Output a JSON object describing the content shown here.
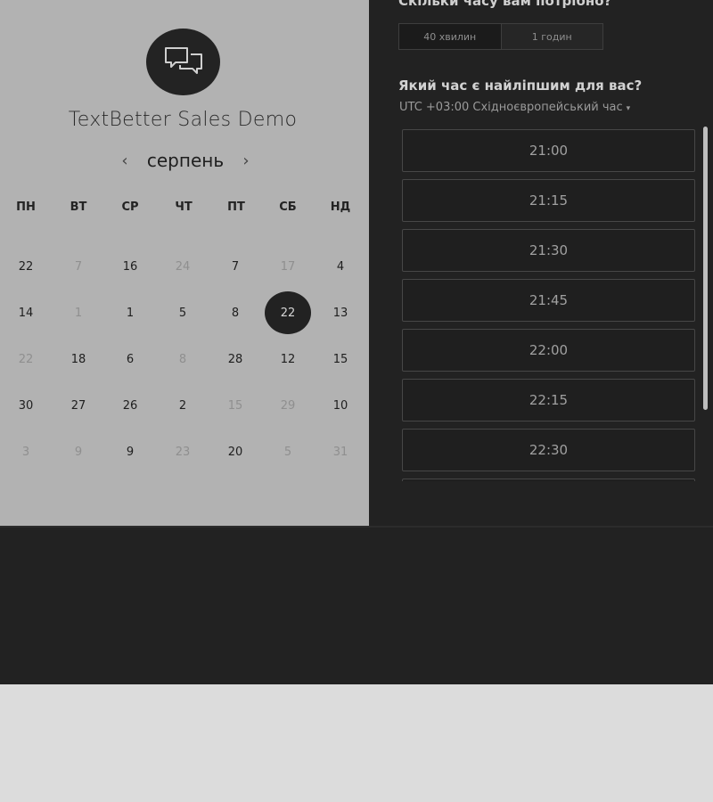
{
  "booking": {
    "title": "TextBetter Sales Demo",
    "month": "серпень",
    "prev_arrow": "‹",
    "next_arrow": "›",
    "weekdays": [
      "ПН",
      "ВТ",
      "СР",
      "ЧТ",
      "ПТ",
      "СБ",
      "НД"
    ],
    "days": [
      [
        "22",
        "7",
        "16",
        "24",
        "7",
        "17",
        "4"
      ],
      [
        "14",
        "1",
        "1",
        "5",
        "8",
        "22",
        "13"
      ],
      [
        "22",
        "18",
        "6",
        "8",
        "28",
        "12",
        "15"
      ],
      [
        "30",
        "27",
        "26",
        "2",
        "15",
        "29",
        "10"
      ],
      [
        "3",
        "9",
        "9",
        "23",
        "20",
        "5",
        "31"
      ]
    ],
    "muted": [
      [
        false,
        true,
        false,
        true,
        false,
        true,
        false
      ],
      [
        false,
        true,
        false,
        false,
        false,
        false,
        false
      ],
      [
        true,
        false,
        false,
        true,
        false,
        false,
        false
      ],
      [
        false,
        false,
        false,
        false,
        true,
        true,
        false
      ],
      [
        true,
        true,
        false,
        true,
        false,
        true,
        true
      ]
    ],
    "selected_day": "22"
  },
  "scheduler": {
    "duration_question": "Скільки часу вам потрібно?",
    "durations": [
      "40 хвилин",
      "1 годин"
    ],
    "time_question": "Який час є найліпшим для вас?",
    "timezone": "UTC +03:00 Східноєвропейський час",
    "timezone_caret": "▾",
    "slots": [
      "21:00",
      "21:15",
      "21:30",
      "21:45",
      "22:00",
      "22:15",
      "22:30",
      ""
    ]
  },
  "colors": {
    "left_panel": "#b2b2b2",
    "dark_panel": "#222222",
    "page_bg": "#dcdcdc"
  },
  "icons": {
    "logo": "chat-bubbles-icon"
  }
}
